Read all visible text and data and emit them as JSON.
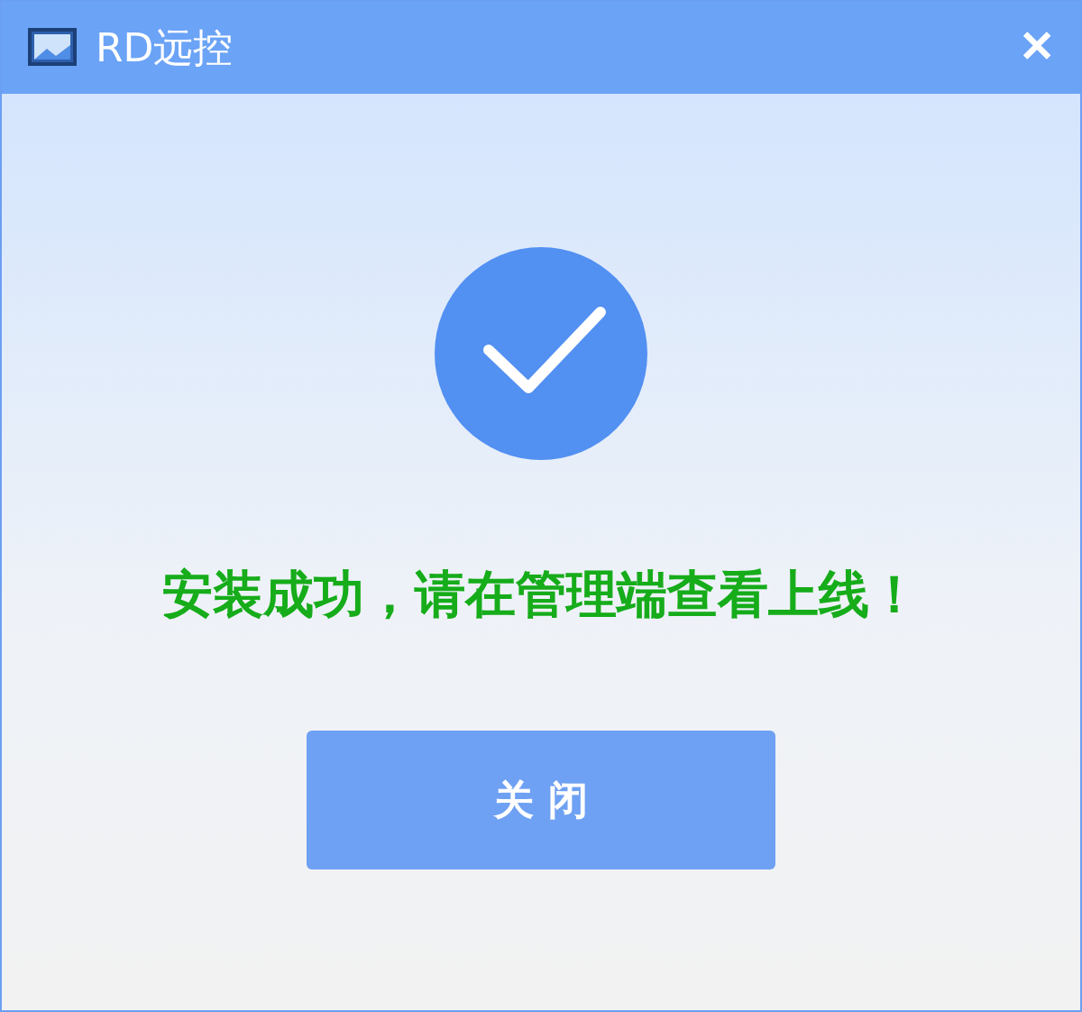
{
  "window": {
    "title": "RD远控",
    "close": "✕"
  },
  "message": "安装成功，请在管理端查看上线！",
  "button": {
    "label": "关 闭"
  }
}
